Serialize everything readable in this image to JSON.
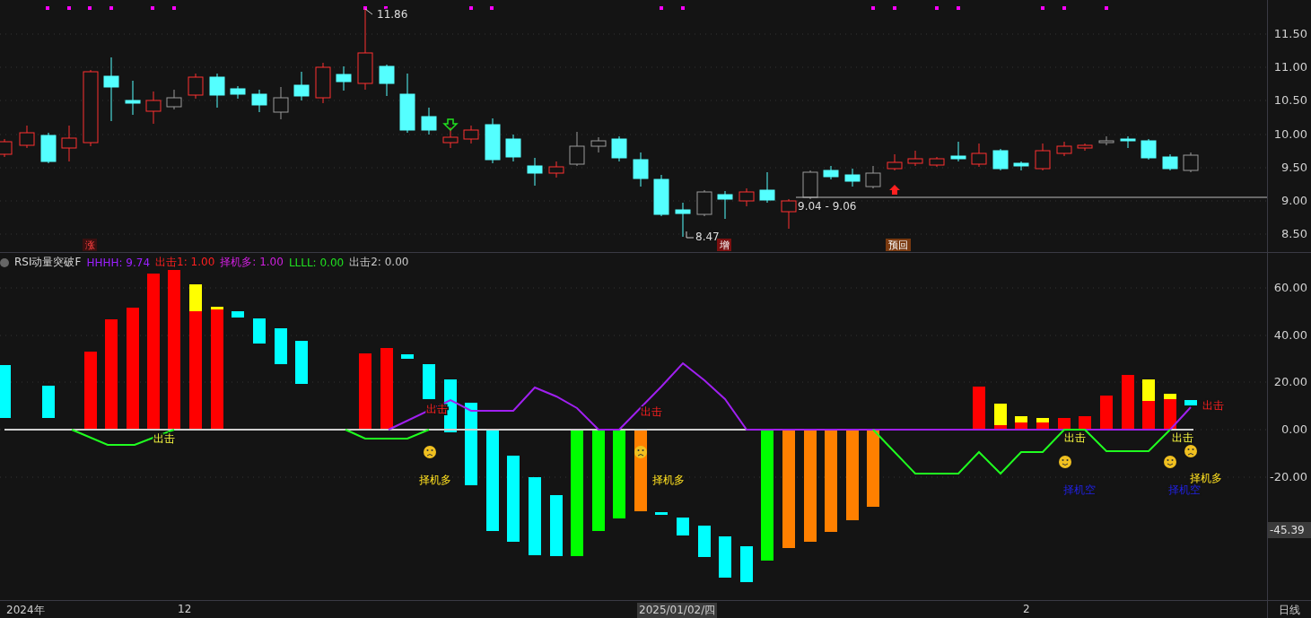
{
  "price_panel": {
    "price_labels": [
      "11.86",
      "8.47",
      "9.04 - 9.06"
    ],
    "tags": [
      {
        "text": "涨",
        "color": "#3a1010"
      },
      {
        "text": "增",
        "color": "#7a1010"
      },
      {
        "text": "预回",
        "color": "#7a3a10"
      }
    ],
    "axis_ticks": [
      "11.50",
      "11.00",
      "10.50",
      "10.00",
      "9.50",
      "9.00",
      "8.50"
    ]
  },
  "indicator_panel": {
    "title": "RSI动量突破F",
    "legend": [
      {
        "text": "HHHH: 9.74",
        "color": "#9b20ff"
      },
      {
        "text": "出击1: 1.00",
        "color": "#ff2020"
      },
      {
        "text": "择机多: 1.00",
        "color": "#d020e0"
      },
      {
        "text": "LLLL: 0.00",
        "color": "#20e020"
      },
      {
        "text": "出击2: 0.00",
        "color": "#c8c8c8"
      }
    ],
    "annotations": [
      {
        "text": "出击",
        "kind": "exit2"
      },
      {
        "text": "出击",
        "kind": "exit"
      },
      {
        "text": "择机多",
        "kind": "long"
      },
      {
        "text": "出击",
        "kind": "exit"
      },
      {
        "text": "择机多",
        "kind": "long"
      },
      {
        "text": "出击",
        "kind": "exit2"
      },
      {
        "text": "择机空",
        "kind": "short"
      },
      {
        "text": "出击",
        "kind": "exit2"
      },
      {
        "text": "择机空",
        "kind": "short"
      },
      {
        "text": "出击",
        "kind": "exit"
      },
      {
        "text": "择机多",
        "kind": "long"
      }
    ],
    "axis_ticks": [
      "60.00",
      "40.00",
      "20.00",
      "0.00",
      "-20.00"
    ],
    "current_value": "-45.39"
  },
  "time_axis": {
    "labels": [
      {
        "text": "2024年",
        "selected": false
      },
      {
        "text": "12",
        "selected": false
      },
      {
        "text": "2025/01/02/四",
        "selected": true
      },
      {
        "text": "2",
        "selected": false
      }
    ],
    "period": "日线"
  }
}
